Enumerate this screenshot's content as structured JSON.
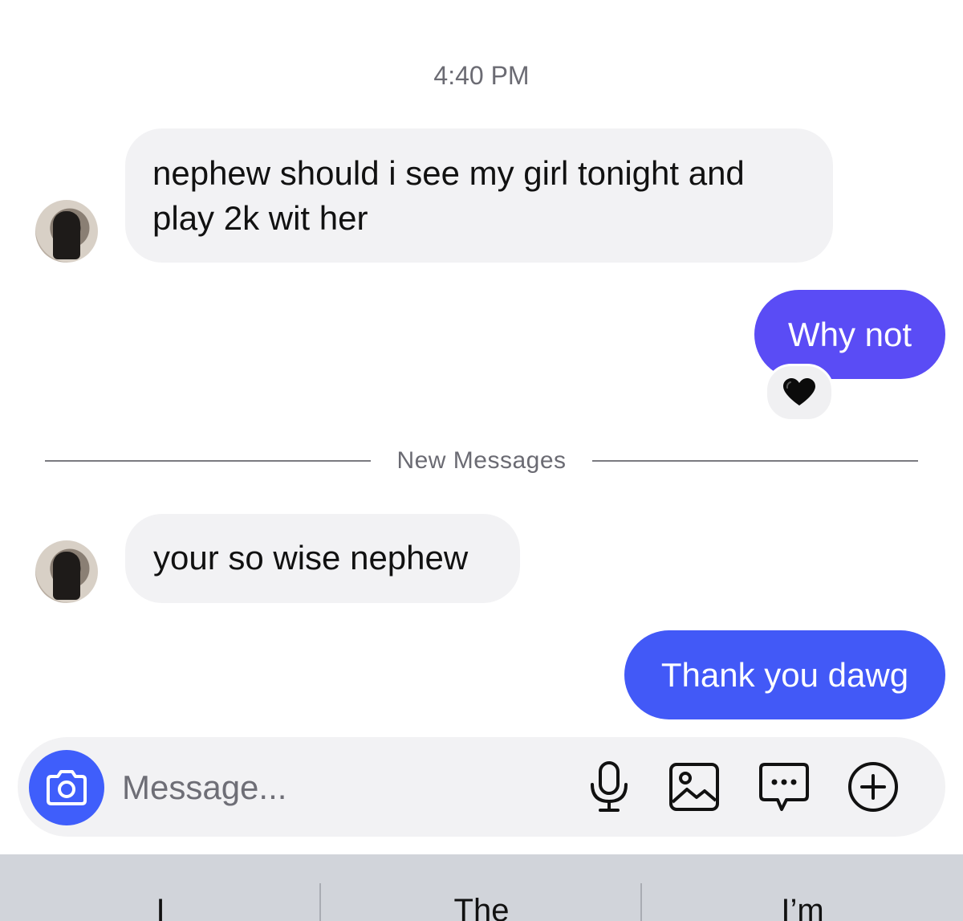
{
  "thread": {
    "timestamp": "4:40 PM",
    "messages": [
      {
        "direction": "incoming",
        "text_lines": [
          "nephew should i see my girl tonight and",
          "play 2k wit her"
        ]
      },
      {
        "direction": "outgoing",
        "text": "Why not",
        "reaction": "black-heart"
      },
      {
        "direction": "incoming",
        "text": "your so wise nephew"
      },
      {
        "direction": "outgoing",
        "text": "Thank you dawg"
      }
    ],
    "divider_label": "New Messages"
  },
  "composer": {
    "placeholder": "Message...",
    "icons": [
      "camera-icon",
      "microphone-icon",
      "gallery-icon",
      "sticker-icon",
      "plus-icon"
    ]
  },
  "keyboard": {
    "suggestions": [
      "I",
      "The",
      "I’m"
    ]
  },
  "colors": {
    "outgoing_top": "#5a4cf5",
    "outgoing_bottom": "#4259f7",
    "incoming_bubble": "#f2f2f4",
    "accent": "#3f5efb",
    "keyboard_bg": "#d1d4da"
  }
}
